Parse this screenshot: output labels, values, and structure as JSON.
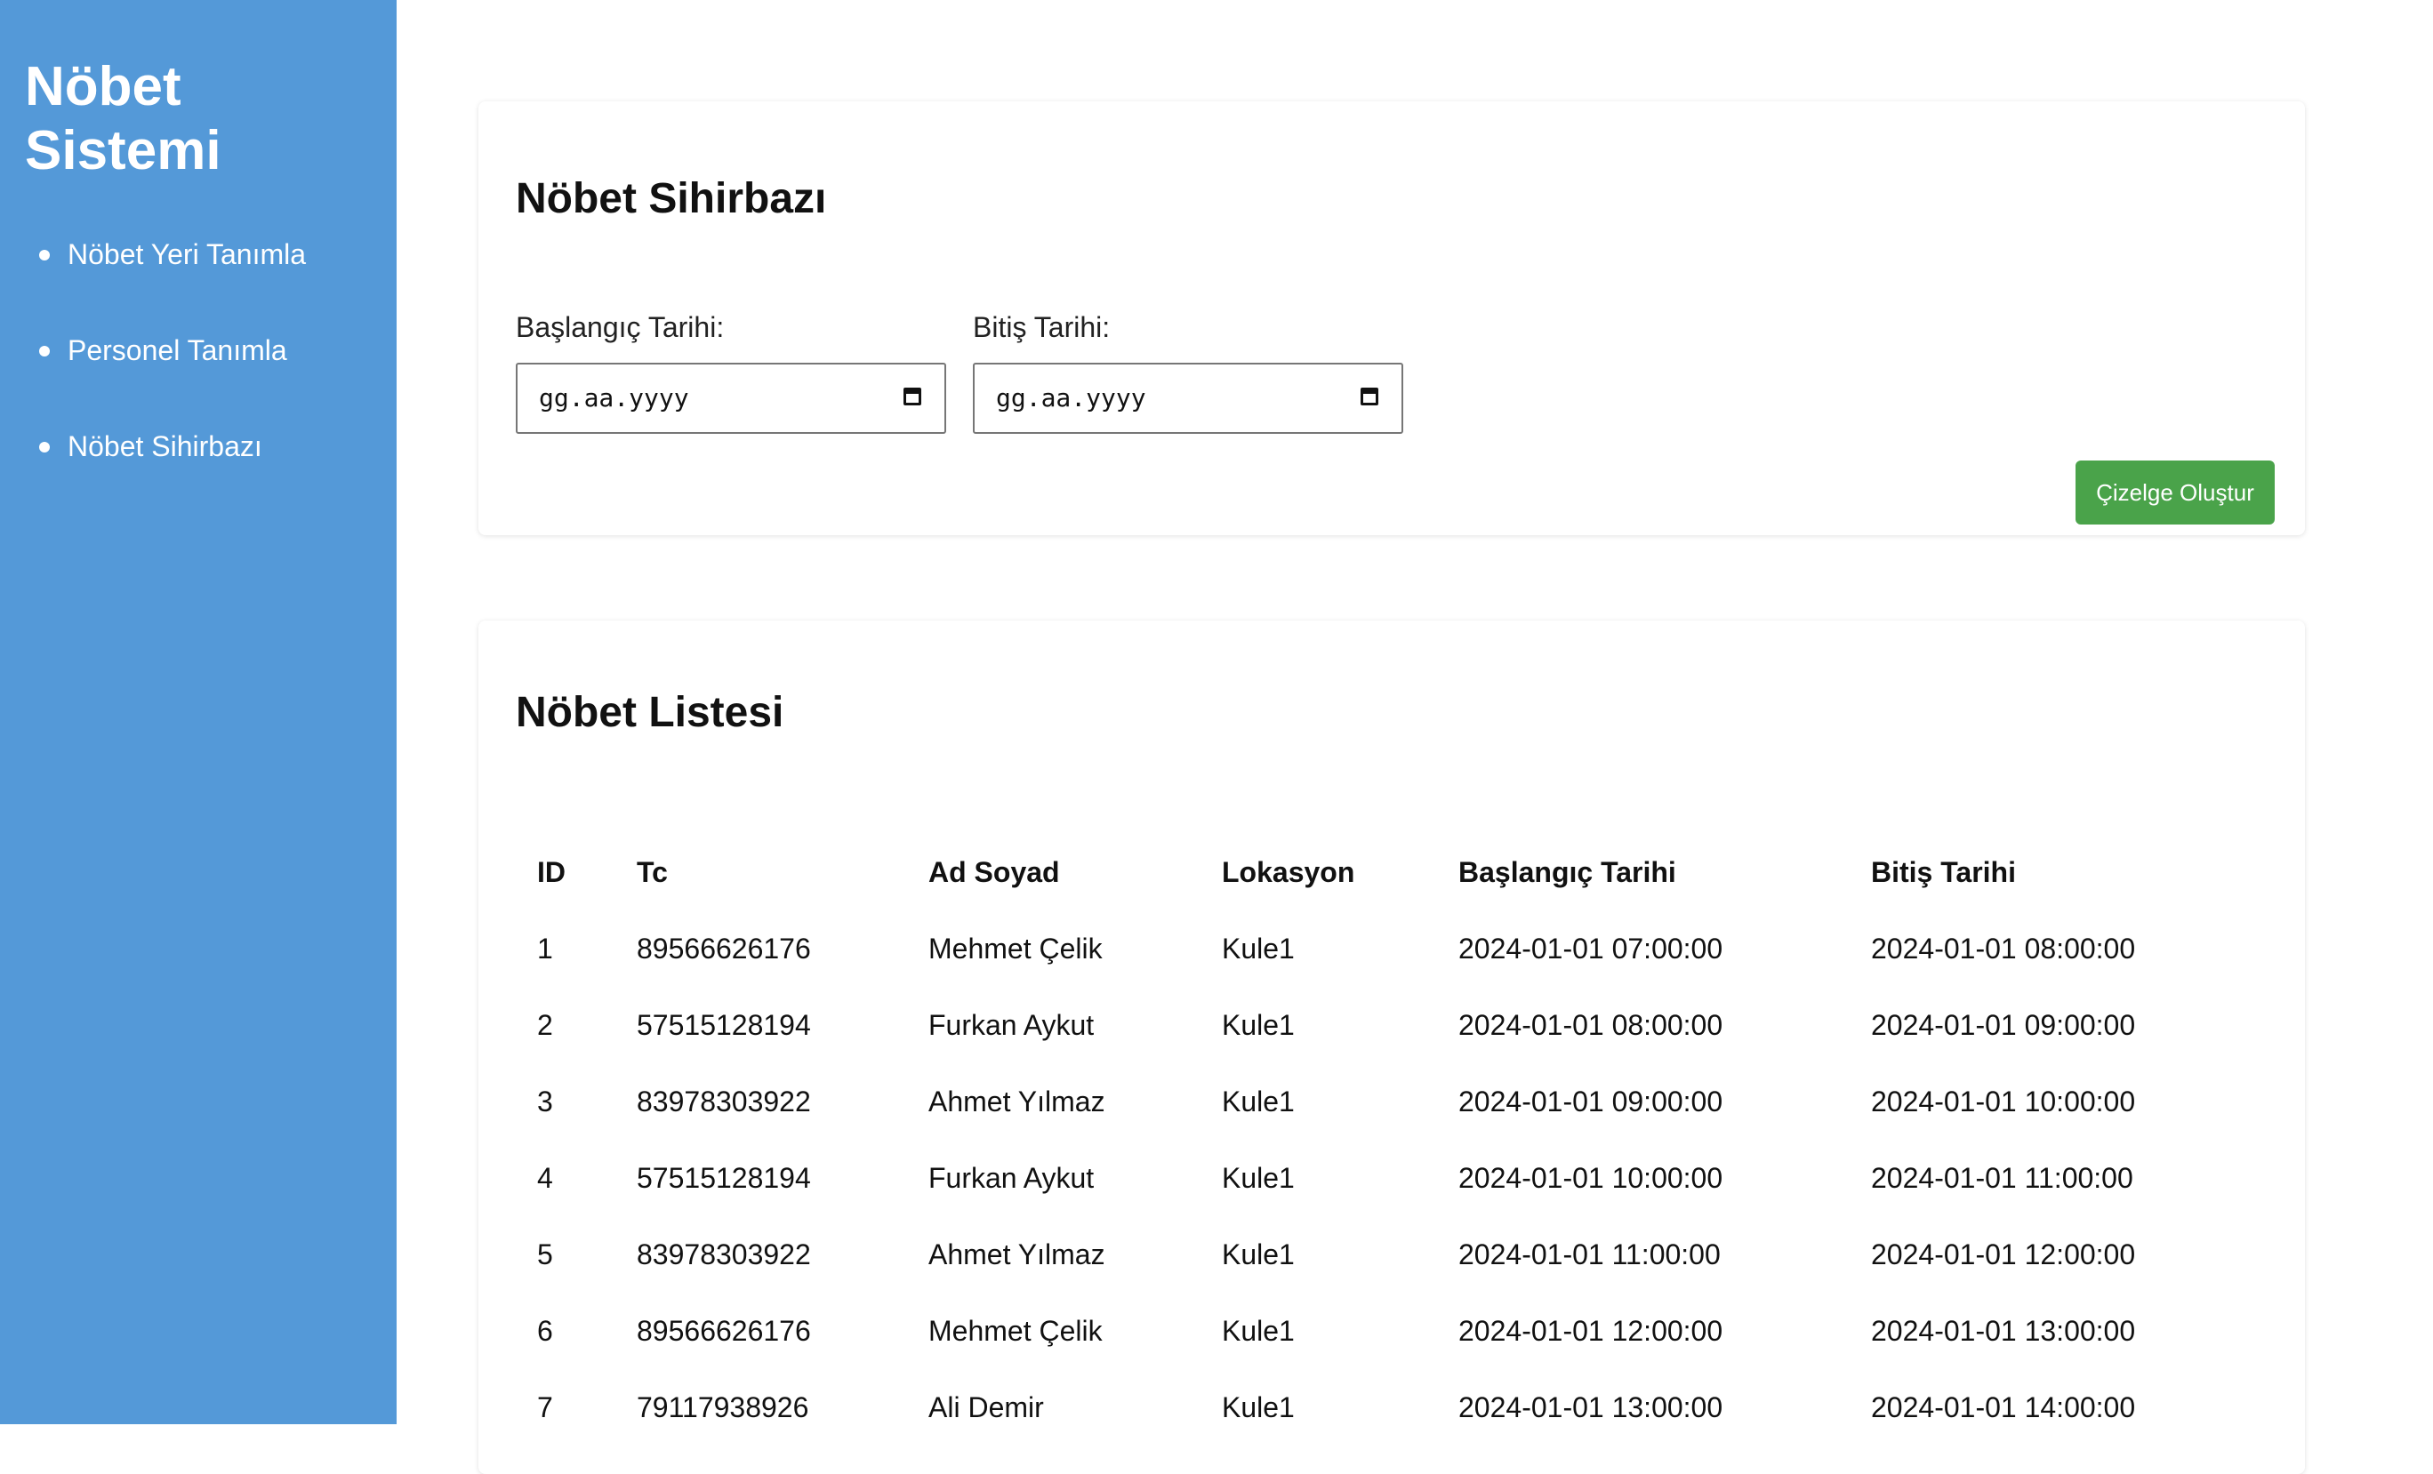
{
  "sidebar": {
    "title_line1": "Nöbet",
    "title_line2": "Sistemi",
    "items": [
      {
        "label": "Nöbet Yeri Tanımla"
      },
      {
        "label": "Personel Tanımla"
      },
      {
        "label": "Nöbet Sihirbazı"
      }
    ]
  },
  "wizard": {
    "title": "Nöbet Sihirbazı",
    "start_label": "Başlangıç Tarihi:",
    "start_placeholder": "gg.aa.yyyy",
    "end_label": "Bitiş Tarihi:",
    "end_placeholder": "gg.aa.yyyy",
    "button_label": "Çizelge Oluştur"
  },
  "list": {
    "title": "Nöbet Listesi",
    "columns": [
      "ID",
      "Tc",
      "Ad Soyad",
      "Lokasyon",
      "Başlangıç Tarihi",
      "Bitiş Tarihi"
    ],
    "rows": [
      [
        "1",
        "89566626176",
        "Mehmet Çelik",
        "Kule1",
        "2024-01-01 07:00:00",
        "2024-01-01 08:00:00"
      ],
      [
        "2",
        "57515128194",
        "Furkan Aykut",
        "Kule1",
        "2024-01-01 08:00:00",
        "2024-01-01 09:00:00"
      ],
      [
        "3",
        "83978303922",
        "Ahmet Yılmaz",
        "Kule1",
        "2024-01-01 09:00:00",
        "2024-01-01 10:00:00"
      ],
      [
        "4",
        "57515128194",
        "Furkan Aykut",
        "Kule1",
        "2024-01-01 10:00:00",
        "2024-01-01 11:00:00"
      ],
      [
        "5",
        "83978303922",
        "Ahmet Yılmaz",
        "Kule1",
        "2024-01-01 11:00:00",
        "2024-01-01 12:00:00"
      ],
      [
        "6",
        "89566626176",
        "Mehmet Çelik",
        "Kule1",
        "2024-01-01 12:00:00",
        "2024-01-01 13:00:00"
      ],
      [
        "7",
        "79117938926",
        "Ali Demir",
        "Kule1",
        "2024-01-01 13:00:00",
        "2024-01-01 14:00:00"
      ]
    ]
  },
  "colors": {
    "sidebar_bg": "#5499d8",
    "button_bg": "#4aa34a"
  }
}
